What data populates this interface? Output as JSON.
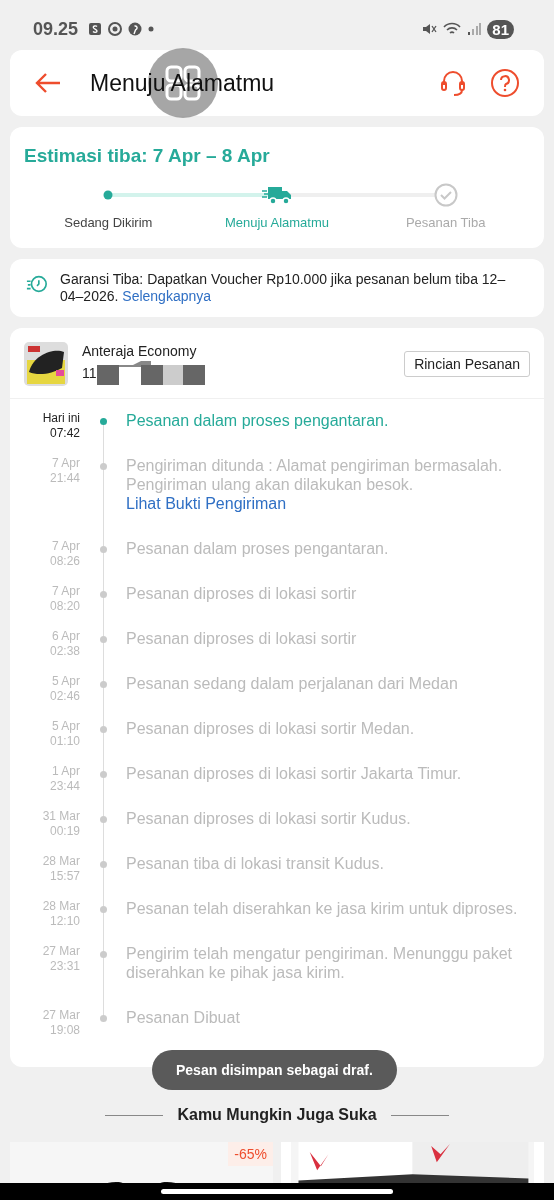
{
  "status_bar": {
    "time": "09.25",
    "battery": "81"
  },
  "header": {
    "title": "Menuju Alamatmu"
  },
  "estimate": {
    "title": "Estimasi tiba: 7 Apr – 8 Apr",
    "steps": [
      {
        "label": "Sedang Dikirim",
        "kind": "done"
      },
      {
        "label": "Menuju Alamatmu",
        "kind": "current"
      },
      {
        "label": "Pesanan Tiba",
        "kind": "pending"
      }
    ]
  },
  "guarantee": {
    "text": "Garansi Tiba: Dapatkan Voucher Rp10.000 jika pesanan belum tiba 12–04–2026.",
    "link": "Selengkapnya"
  },
  "shipment": {
    "courier": "Anteraja Economy",
    "tracking_number": "11",
    "details_button": "Rincian Pesanan"
  },
  "events": [
    {
      "date": "Hari ini",
      "time": "07:42",
      "text": "Pesanan dalam proses pengantaran.",
      "current": true
    },
    {
      "date": "7 Apr",
      "time": "21:44",
      "text": "Pengiriman ditunda : Alamat pengiriman bermasalah. Pengiriman ulang akan dilakukan besok.",
      "link": "Lihat Bukti Pengiriman",
      "current": false
    },
    {
      "date": "7 Apr",
      "time": "08:26",
      "text": "Pesanan dalam proses pengantaran.",
      "current": false
    },
    {
      "date": "7 Apr",
      "time": "08:20",
      "text": "Pesanan diproses di lokasi sortir",
      "current": false
    },
    {
      "date": "6 Apr",
      "time": "02:38",
      "text": "Pesanan diproses di lokasi sortir",
      "current": false
    },
    {
      "date": "5 Apr",
      "time": "02:46",
      "text": "Pesanan sedang dalam perjalanan dari Medan",
      "current": false
    },
    {
      "date": "5 Apr",
      "time": "01:10",
      "text": "Pesanan diproses di lokasi sortir  Medan.",
      "current": false
    },
    {
      "date": "1 Apr",
      "time": "23:44",
      "text": "Pesanan diproses di lokasi sortir  Jakarta Timur.",
      "current": false
    },
    {
      "date": "31 Mar",
      "time": "00:19",
      "text": "Pesanan diproses di lokasi sortir  Kudus.",
      "current": false
    },
    {
      "date": "28 Mar",
      "time": "15:57",
      "text": "Pesanan tiba di lokasi transit  Kudus.",
      "current": false
    },
    {
      "date": "28 Mar",
      "time": "12:10",
      "text": "Pesanan telah diserahkan ke jasa kirim untuk diproses.",
      "current": false
    },
    {
      "date": "27 Mar",
      "time": "23:31",
      "text": "Pengirim telah mengatur pengiriman. Menunggu paket diserahkan ke pihak jasa kirim.",
      "current": false
    },
    {
      "date": "27 Mar",
      "time": "19:08",
      "text": "Pesanan Dibuat",
      "current": false
    }
  ],
  "recommendations": {
    "title": "Kamu Mungkin Juga Suka",
    "products": [
      {
        "kind": "picture",
        "discount": "-65%"
      },
      {
        "kind": "picture"
      }
    ]
  },
  "toast": {
    "text": "Pesan disimpan sebagai draf."
  }
}
